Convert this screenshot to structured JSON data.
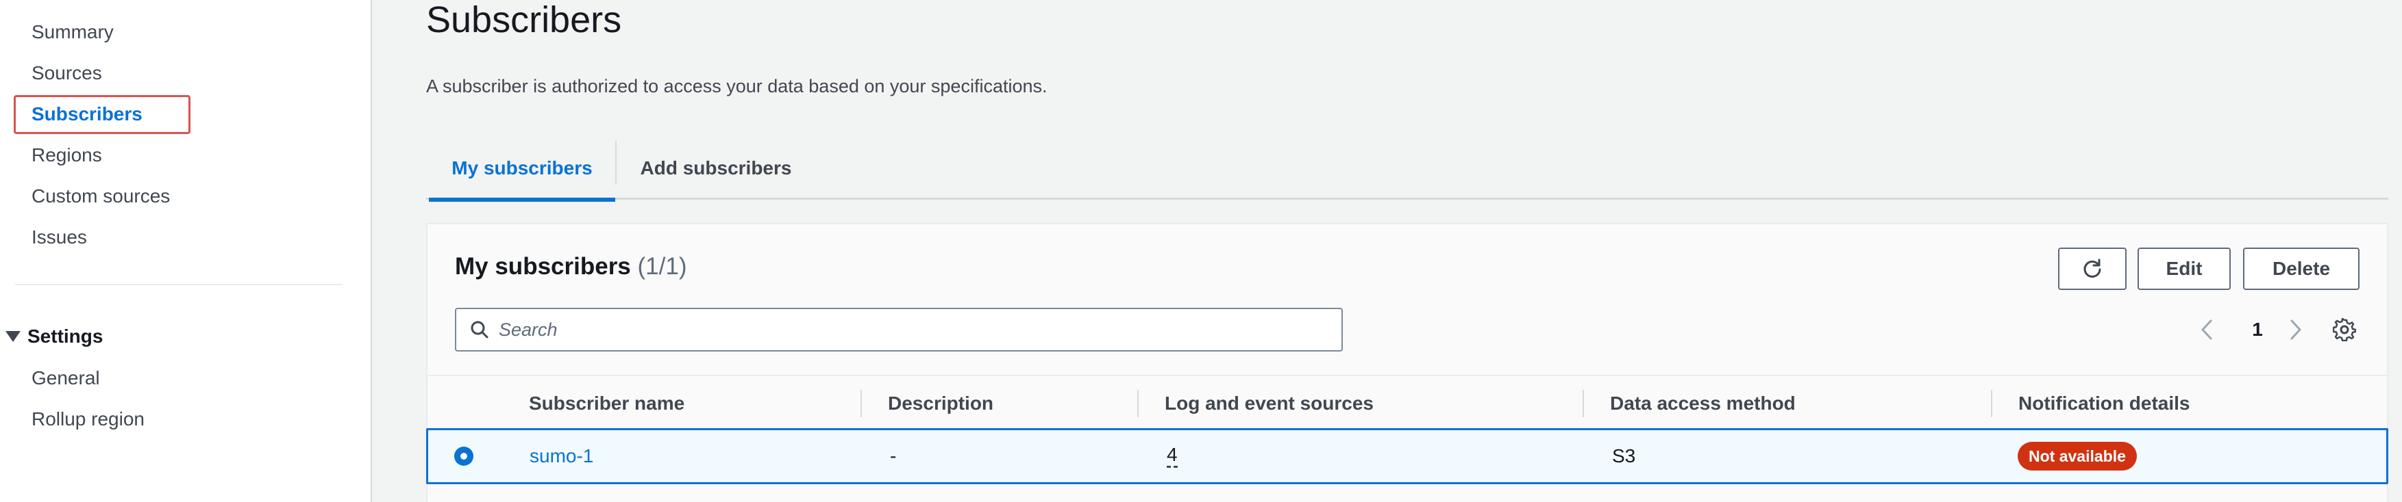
{
  "sidebar": {
    "items": [
      {
        "label": "Summary"
      },
      {
        "label": "Sources"
      },
      {
        "label": "Subscribers"
      },
      {
        "label": "Regions"
      },
      {
        "label": "Custom sources"
      },
      {
        "label": "Issues"
      }
    ],
    "settings": {
      "label": "Settings",
      "items": [
        {
          "label": "General"
        },
        {
          "label": "Rollup region"
        }
      ]
    }
  },
  "page": {
    "title": "Subscribers",
    "description": "A subscriber is authorized to access your data based on your specifications."
  },
  "tabs": [
    {
      "label": "My subscribers"
    },
    {
      "label": "Add subscribers"
    }
  ],
  "table": {
    "title": "My subscribers",
    "count": "(1/1)",
    "buttons": {
      "edit": "Edit",
      "delete": "Delete"
    },
    "search": {
      "placeholder": "Search",
      "value": ""
    },
    "pagination": {
      "current_page": "1"
    },
    "columns": [
      "Subscriber name",
      "Description",
      "Log and event sources",
      "Data access method",
      "Notification details"
    ],
    "rows": [
      {
        "subscriber_name": "sumo-1",
        "description": "-",
        "log_and_event_sources": "4",
        "data_access_method": "S3",
        "notification_details": "Not available",
        "selected": true
      }
    ]
  },
  "colors": {
    "accent": "#0972d3",
    "active_outline": "#d9534f",
    "badge_error": "#d13212",
    "selected_row_bg": "#f1faff"
  },
  "icons": [
    "refresh-icon",
    "search-icon",
    "chevron-left-icon",
    "chevron-right-icon",
    "settings-gear-icon",
    "caret-down-icon"
  ]
}
